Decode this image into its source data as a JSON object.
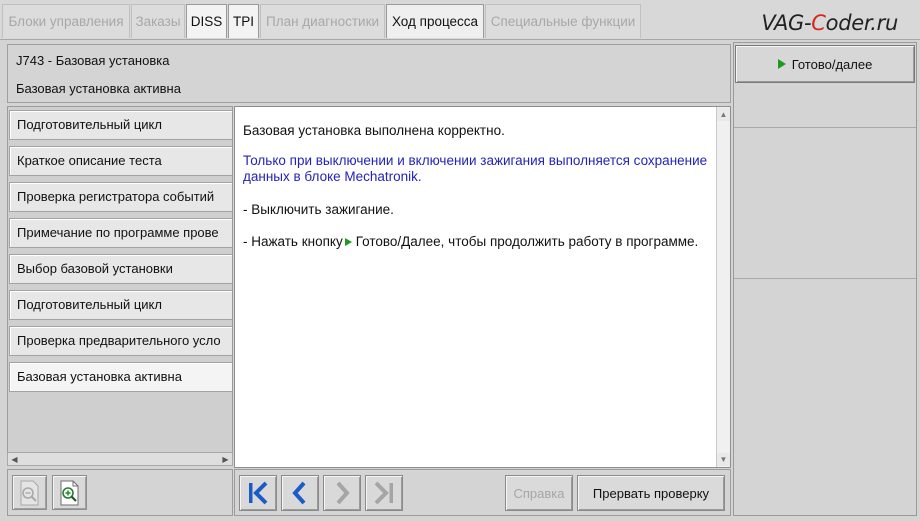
{
  "tabs": [
    {
      "label": "Блоки управления",
      "state": "disabled"
    },
    {
      "label": "Заказы",
      "state": "disabled"
    },
    {
      "label": "DISS",
      "state": "enabled"
    },
    {
      "label": "TPI",
      "state": "enabled"
    },
    {
      "label": "План диагностики",
      "state": "disabled"
    },
    {
      "label": "Ход процесса",
      "state": "active"
    },
    {
      "label": "Специальные функции",
      "state": "disabled"
    }
  ],
  "brand": {
    "part1": "VAG-",
    "part2": "C",
    "part3": "oder.ru"
  },
  "header": {
    "title": "J743 - Базовая установка",
    "subtitle": "Базовая установка активна"
  },
  "right_panel": {
    "next_button_label": "Готово/далее"
  },
  "steps": [
    "Подготовительный цикл",
    "Краткое описание теста",
    "Проверка регистратора событий",
    "Примечание по программе прове",
    "Выбор базовой установки",
    "Подготовительный цикл",
    "Проверка предварительного усло",
    "Базовая установка активна"
  ],
  "content": {
    "msg1": "Базовая установка выполнена корректно.",
    "msg2": "Только при выключении и включении зажигания выполняется сохранение данных в блоке Mechatronik.",
    "msg3": "- Выключить зажигание.",
    "msg4_before": "- Нажать кнопку",
    "msg4_after": "Готово/Далее, чтобы продолжить работу в программе."
  },
  "toolbar": {
    "help_label": "Справка",
    "abort_label": "Прервать проверку"
  },
  "icons": {
    "zoom_out": "zoom-out-icon",
    "zoom_in": "zoom-in-icon",
    "first": "first-step-icon",
    "prev": "previous-step-icon",
    "next": "next-step-icon",
    "last": "last-step-icon"
  },
  "colors": {
    "accent_blue": "#2323b8",
    "nav_blue": "#1b5bc7",
    "play_green": "#1e9a1e",
    "brand_red": "#d8261c"
  }
}
